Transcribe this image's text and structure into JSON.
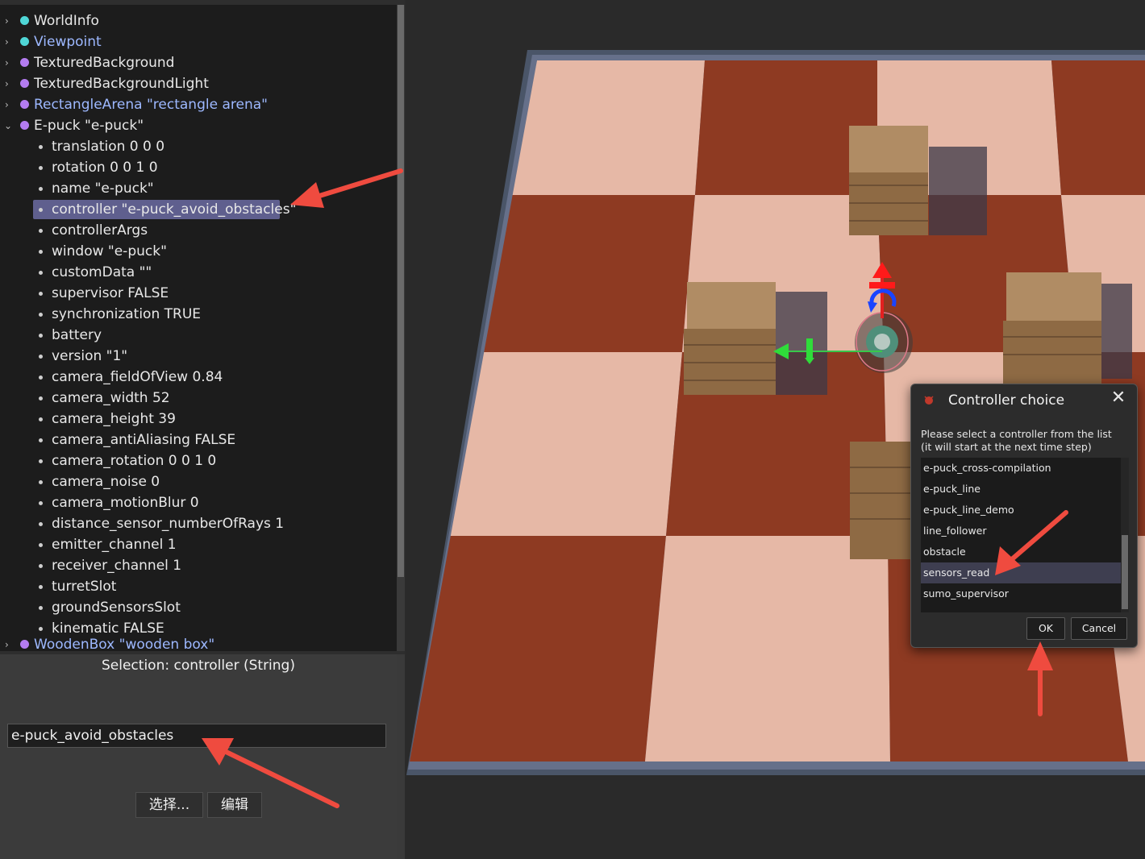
{
  "tree": {
    "nodes": [
      {
        "label": "WorldInfo",
        "dot": "cyan",
        "link": false
      },
      {
        "label": "Viewpoint",
        "dot": "cyan",
        "link": true
      },
      {
        "label": "TexturedBackground",
        "dot": "violet",
        "link": false
      },
      {
        "label": "TexturedBackgroundLight",
        "dot": "violet",
        "link": false
      },
      {
        "label": "RectangleArena \"rectangle arena\"",
        "dot": "violet",
        "link": true
      },
      {
        "label": "E-puck \"e-puck\"",
        "dot": "violet",
        "link": false,
        "expanded": true
      }
    ],
    "fields": [
      "translation 0 0 0",
      "rotation 0 0 1 0",
      "name \"e-puck\"",
      "controller \"e-puck_avoid_obstacles\"",
      "controllerArgs",
      "window \"e-puck\"",
      "customData \"\"",
      "supervisor FALSE",
      "synchronization TRUE",
      "battery",
      "version \"1\"",
      "camera_fieldOfView 0.84",
      "camera_width 52",
      "camera_height 39",
      "camera_antiAliasing FALSE",
      "camera_rotation 0 0 1 0",
      "camera_noise 0",
      "camera_motionBlur 0",
      "distance_sensor_numberOfRays 1",
      "emitter_channel 1",
      "receiver_channel 1",
      "turretSlot",
      "groundSensorsSlot",
      "kinematic FALSE"
    ],
    "selected_field": "controller \"e-puck_avoid_obstacles\"",
    "last_node": "WoodenBox \"wooden box\""
  },
  "editor": {
    "selection_label": "Selection: controller (String)",
    "value": "e-puck_avoid_obstacles",
    "select_button": "选择...",
    "edit_button": "编辑"
  },
  "dialog": {
    "title": "Controller choice",
    "close_icon": "close-icon",
    "message_line1": "Please select a controller from the list",
    "message_line2": "(it will start at the next time step)",
    "items": [
      "e-puck_cross-compilation",
      "e-puck_line",
      "e-puck_line_demo",
      "line_follower",
      "obstacle",
      "sensors_read",
      "sumo_supervisor"
    ],
    "selected_item": "sensors_read",
    "ok_label": "OK",
    "cancel_label": "Cancel"
  },
  "colors": {
    "annotation_arrow": "#ef4b3f",
    "selection_highlight": "#5f5f8e",
    "floor_dark": "#8e3a22",
    "floor_light": "#e6b8a6"
  }
}
